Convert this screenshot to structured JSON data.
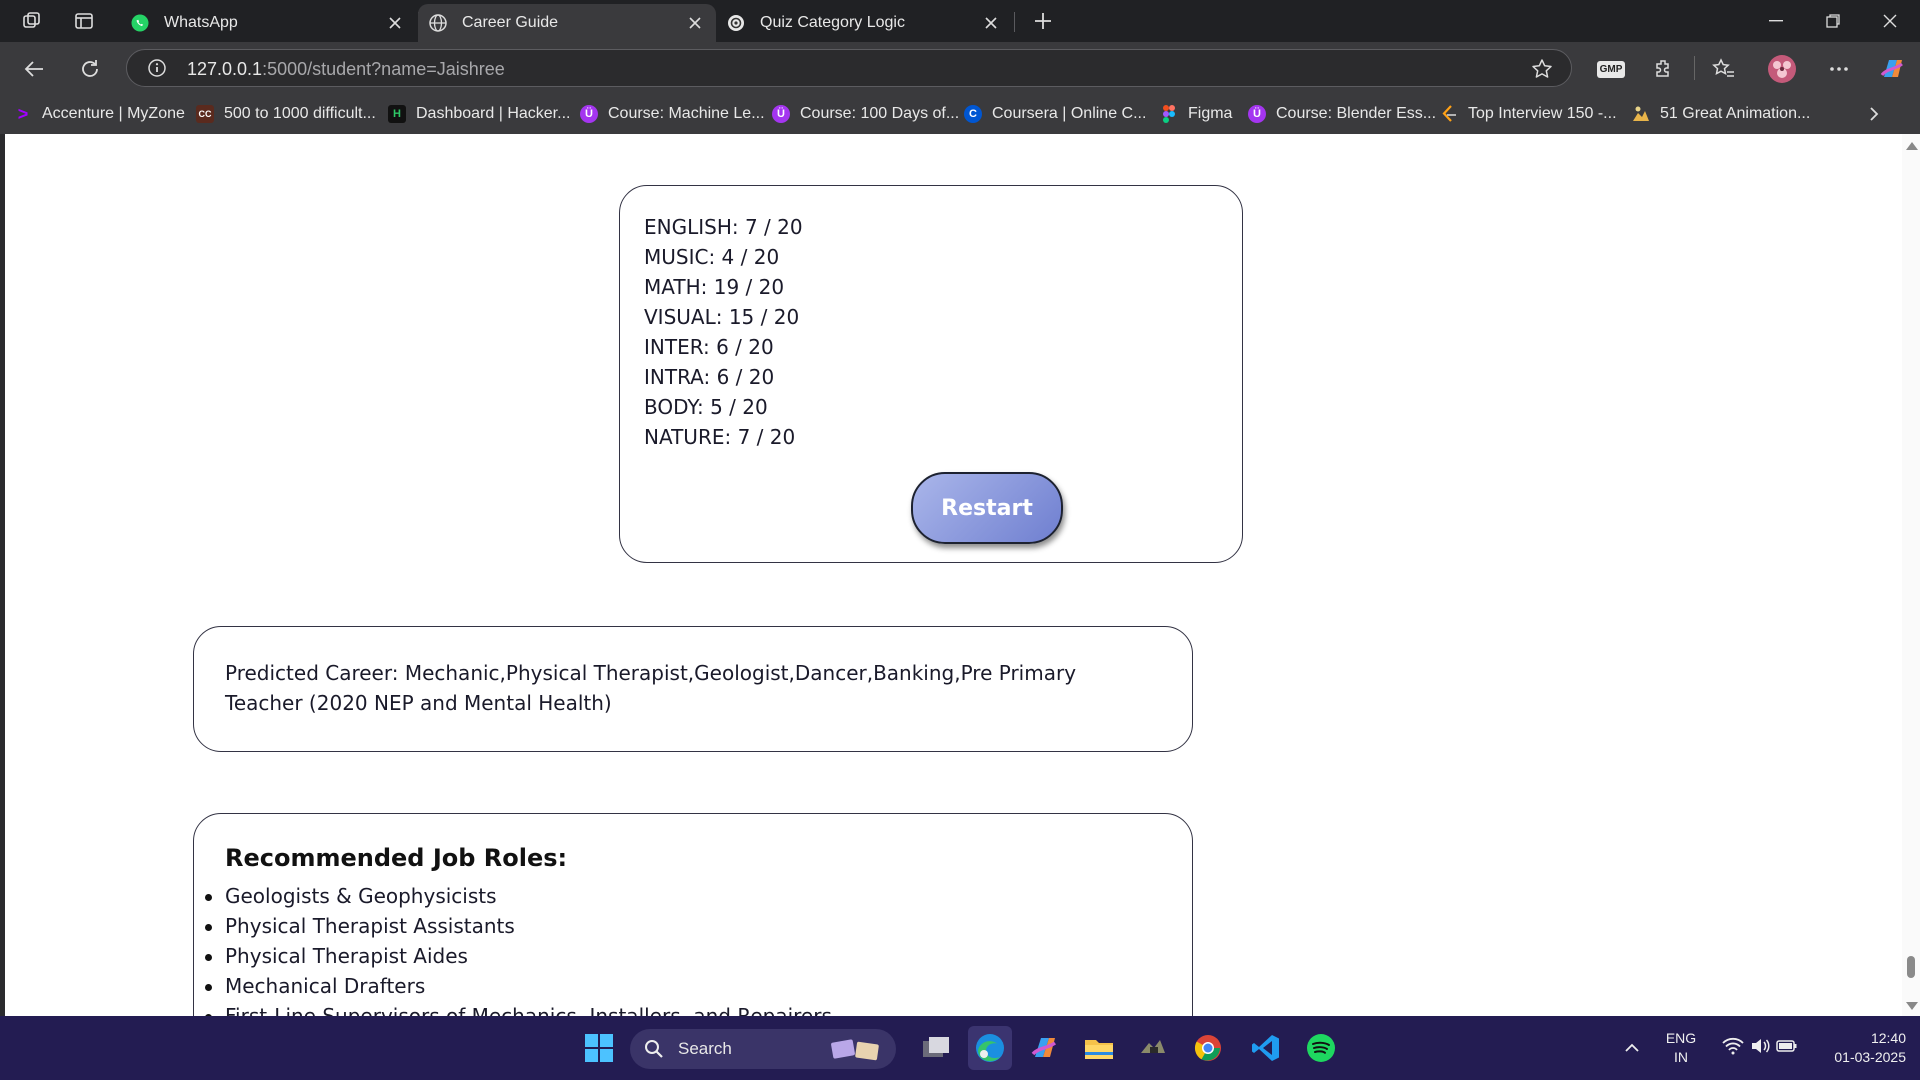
{
  "browser": {
    "tabs": [
      {
        "title": "WhatsApp",
        "icon": "whatsapp-icon",
        "active": false
      },
      {
        "title": "Career Guide",
        "icon": "globe-icon",
        "active": true
      },
      {
        "title": "Quiz Category Logic",
        "icon": "chatgpt-icon",
        "active": false
      }
    ],
    "address": {
      "host": "127.0.0.1",
      "path": ":5000/student?name=Jaishree"
    },
    "extension_label": "GMP",
    "bookmarks": [
      {
        "label": "Accenture | MyZone",
        "icon": "accenture-icon",
        "icon_text": ">"
      },
      {
        "label": "500 to 1000 difficult...",
        "icon": "cc-icon",
        "icon_text": "CC"
      },
      {
        "label": "Dashboard | Hacker...",
        "icon": "hackerrank-icon",
        "icon_text": "H"
      },
      {
        "label": "Course: Machine Le...",
        "icon": "udemy-icon",
        "icon_text": "Ü"
      },
      {
        "label": "Course: 100 Days of...",
        "icon": "udemy-icon",
        "icon_text": "Ü"
      },
      {
        "label": "Coursera | Online C...",
        "icon": "coursera-icon",
        "icon_text": "C"
      },
      {
        "label": "Figma",
        "icon": "figma-icon",
        "icon_text": ""
      },
      {
        "label": "Course: Blender Ess...",
        "icon": "udemy-icon",
        "icon_text": "Ü"
      },
      {
        "label": "Top Interview 150 -...",
        "icon": "leetcode-icon",
        "icon_text": ""
      },
      {
        "label": "51 Great Animation...",
        "icon": "animation-icon",
        "icon_text": ""
      }
    ]
  },
  "page": {
    "scores": [
      "ENGLISH: 7 / 20",
      "MUSIC: 4 / 20",
      "MATH: 19 / 20",
      "VISUAL: 15 / 20",
      "INTER: 6 / 20",
      "INTRA: 6 / 20",
      "BODY: 5 / 20",
      "NATURE: 7 / 20"
    ],
    "restart_label": "Restart",
    "predicted_career": "Predicted Career: Mechanic,Physical Therapist,Geologist,Dancer,Banking,Pre Primary Teacher (2020 NEP and Mental Health)",
    "jobs_title": "Recommended Job Roles:",
    "jobs": [
      "Geologists & Geophysicists",
      "Physical Therapist Assistants",
      "Physical Therapist Aides",
      "Mechanical Drafters",
      "First-Line Supervisors of Mechanics, Installers, and Repairers"
    ]
  },
  "taskbar": {
    "search_label": "Search",
    "lang_top": "ENG",
    "lang_bottom": "IN",
    "time": "12:40",
    "date": "01-03-2025"
  },
  "colors": {
    "accent": "#6f7fd0",
    "taskbar": "#231c52",
    "browser_bg": "#202124"
  }
}
